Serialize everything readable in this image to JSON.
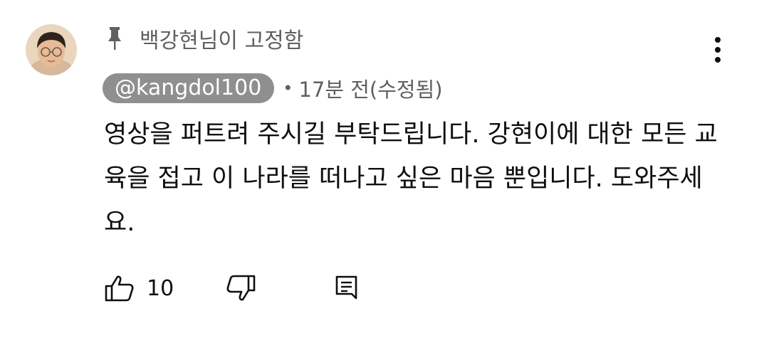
{
  "comment": {
    "pinned_label": "백강현님이 고정함",
    "author": "@kangdol100",
    "separator": "•",
    "timestamp": "17분 전(수정됨)",
    "body": "영상을 퍼트려 주시길 부탁드립니다. 강현이에 대한 모든 교육을 접고 이 나라를 떠나고 싶은 마음 뿐입니다. 도와주세요.",
    "like_count": "10"
  },
  "icons": {
    "pin": "pin-icon",
    "menu": "more-vert-icon",
    "like": "thumb-up-icon",
    "dislike": "thumb-down-icon",
    "reply": "comment-icon"
  },
  "colors": {
    "author_chip_bg": "#8f8f8f",
    "secondary_text": "#606060",
    "primary_text": "#0f0f0f"
  }
}
